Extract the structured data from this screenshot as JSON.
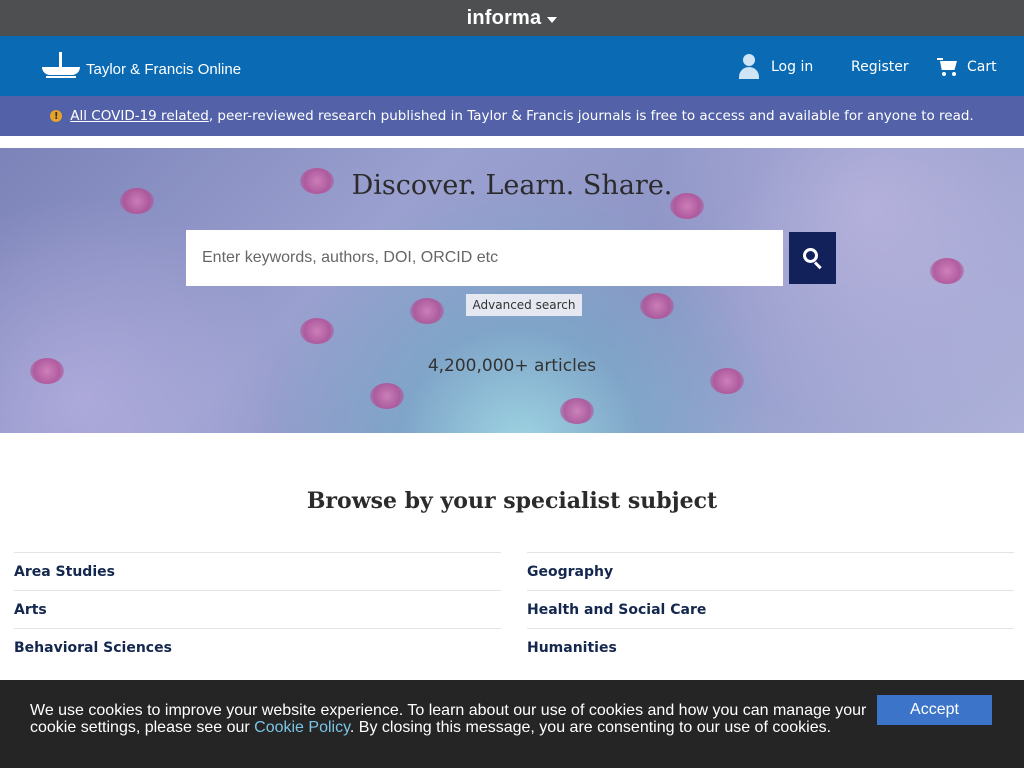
{
  "topbar": {
    "brand": "informa"
  },
  "header": {
    "logo_text": "Taylor & Francis Online",
    "nav": {
      "login": "Log in",
      "register": "Register",
      "cart": "Cart"
    }
  },
  "covid_banner": {
    "link": "All COVID-19 related",
    "text": ", peer-reviewed research published in Taylor & Francis journals is free to access and available for anyone to read."
  },
  "hero": {
    "title": "Discover. Learn. Share.",
    "search_placeholder": "Enter keywords, authors, DOI, ORCID etc",
    "advanced_search": "Advanced search",
    "article_count": "4,200,000+ articles"
  },
  "browse": {
    "heading": "Browse by your specialist subject",
    "left": [
      "Area Studies",
      "Arts",
      "Behavioral Sciences"
    ],
    "right": [
      "Geography",
      "Health and Social Care",
      "Humanities"
    ]
  },
  "cookie": {
    "text_before": "We use cookies to improve your website experience. To learn about our use of cookies and how you can manage your cookie settings, please see our ",
    "link": "Cookie Policy",
    "text_after": ". By closing this message, you are consenting to our use of cookies.",
    "accept": "Accept"
  },
  "colors": {
    "topbar": "#4d4f51",
    "header": "#0a6bb4",
    "banner": "#5362a8",
    "search_button": "#13215b",
    "accept_button": "#3b74c9",
    "cookie_bg": "#252525"
  }
}
